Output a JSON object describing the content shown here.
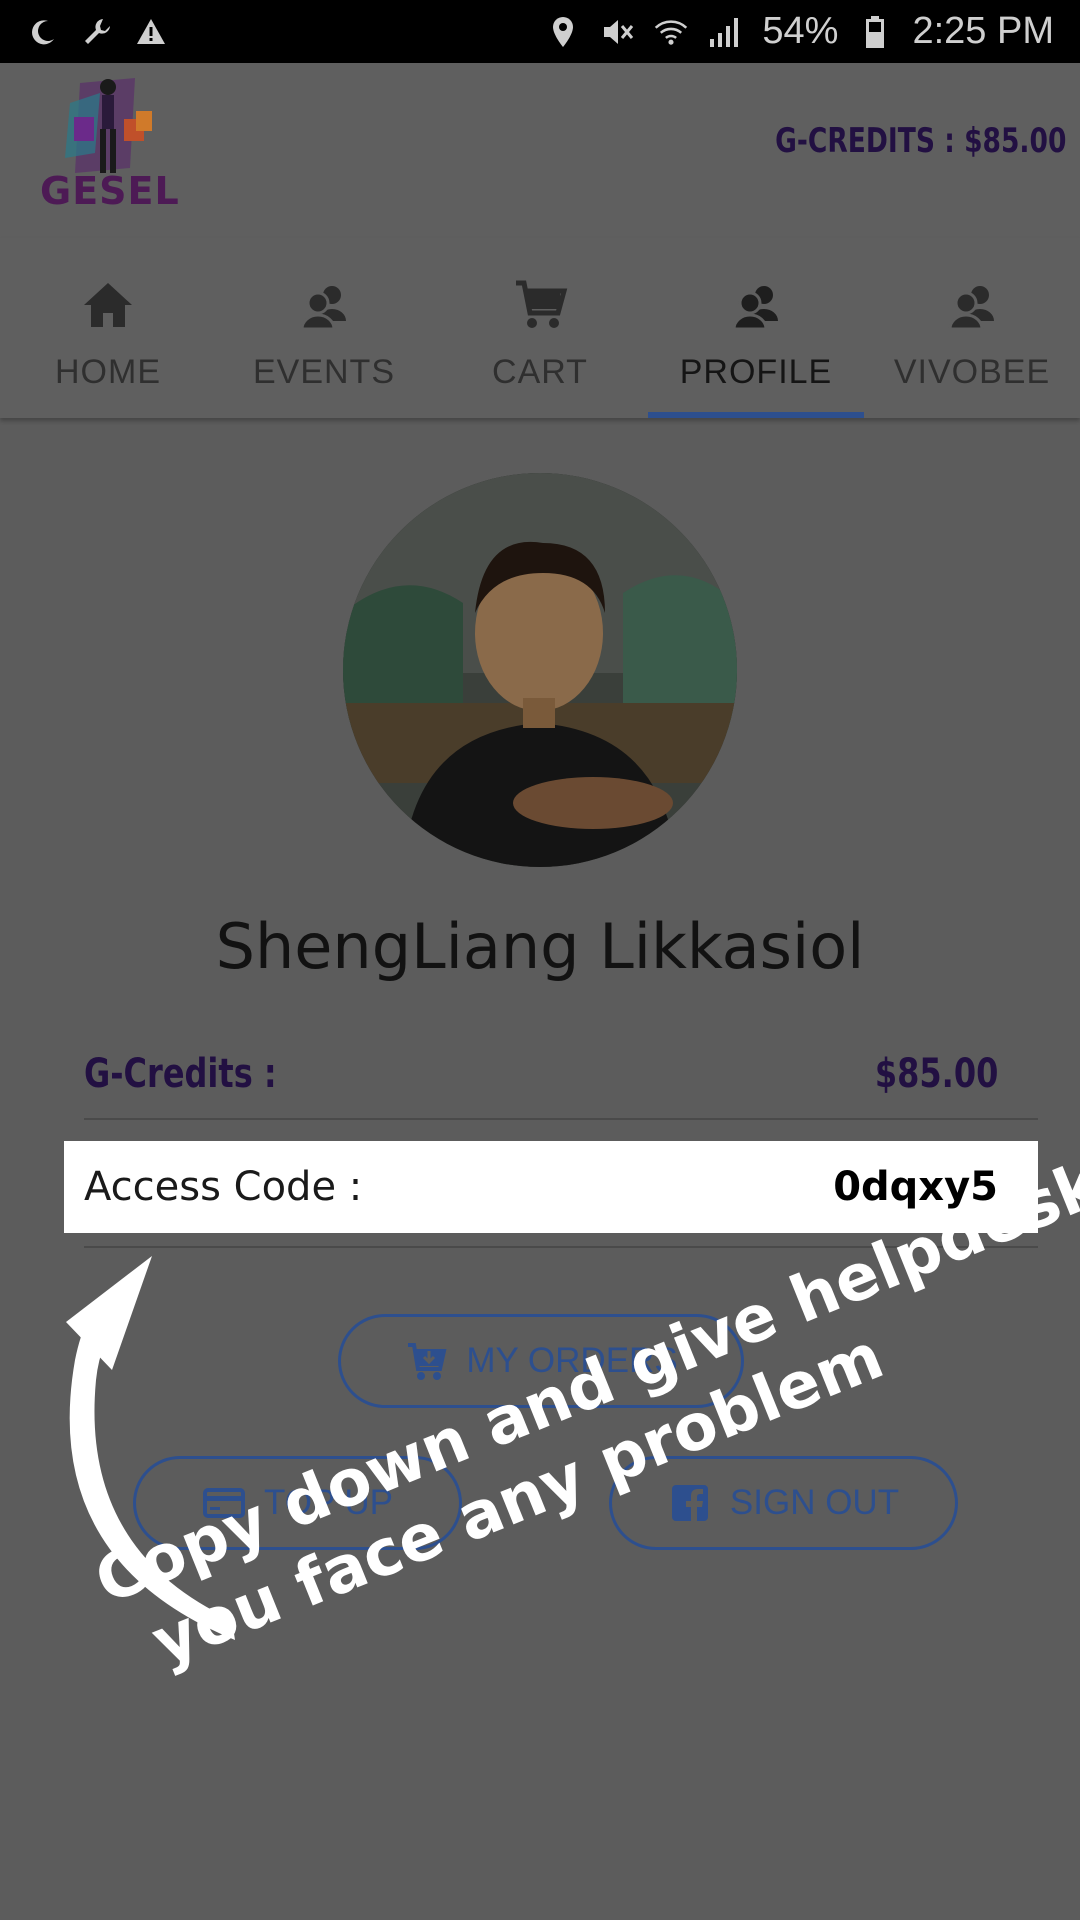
{
  "status_bar": {
    "battery": "54%",
    "time": "2:25 PM",
    "icons_left": [
      "moon-icon",
      "wrench-icon",
      "warning-icon"
    ],
    "icons_right": [
      "location-icon",
      "mute-icon",
      "wifi-icon",
      "signal-icon",
      "battery-icon"
    ]
  },
  "header": {
    "logo_text": "GESEL",
    "credits": "G-CREDITS : $85.00"
  },
  "tabs": [
    {
      "label": "HOME",
      "icon": "home-icon",
      "active": false
    },
    {
      "label": "EVENTS",
      "icon": "people-icon",
      "active": false
    },
    {
      "label": "CART",
      "icon": "cart-icon",
      "active": false
    },
    {
      "label": "PROFILE",
      "icon": "people-icon",
      "active": true
    },
    {
      "label": "VIVOBEE",
      "icon": "people-icon",
      "active": false
    }
  ],
  "profile": {
    "name": "ShengLiang Likkasiol",
    "credits_label": "G-Credits :",
    "credits_value": "$85.00",
    "access_label": "Access Code :",
    "access_value": "0dqxy5"
  },
  "buttons": {
    "orders": "MY ORDERS",
    "topup": "TOP UP",
    "signout": "SIGN OUT"
  },
  "annotation": {
    "line1": "Copy down and give helpdesk if",
    "line2": "you  face any problem"
  },
  "colors": {
    "accent": "#2d4f8e",
    "credits": "#221042",
    "overlay_bg": "#5c5c5c"
  }
}
